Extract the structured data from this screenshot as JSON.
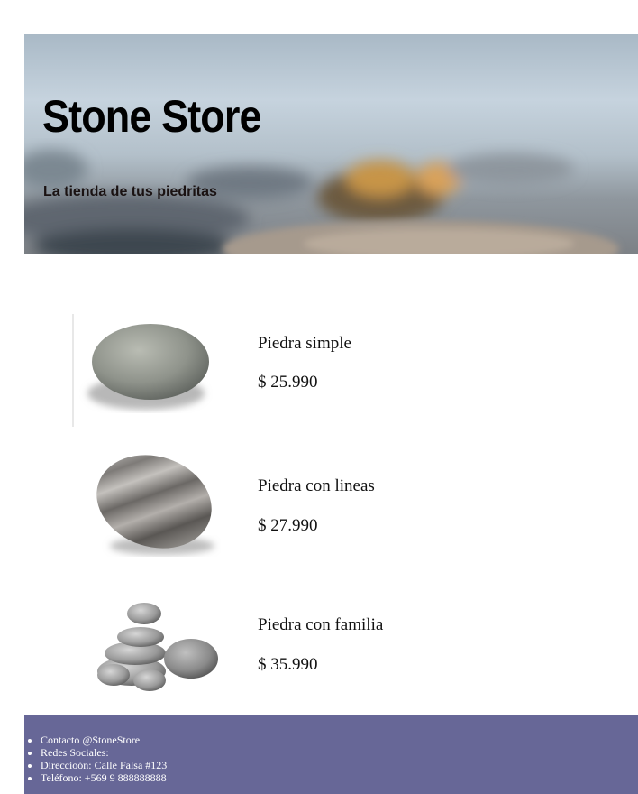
{
  "hero": {
    "title": "Stone Store",
    "tagline": "La tienda de tus piedritas"
  },
  "products": [
    {
      "name": "Piedra simple",
      "price": "$ 25.990",
      "image": "smooth-gray-stone"
    },
    {
      "name": "Piedra con lineas",
      "price": "$ 27.990",
      "image": "striped-stone"
    },
    {
      "name": "Piedra con familia",
      "price": "$ 35.990",
      "image": "stone-stack"
    }
  ],
  "footer": {
    "items": [
      "Contacto @StoneStore",
      "Redes Sociales:",
      "Direccioón: Calle Falsa #123",
      "Teléfono: +569 9 888888888"
    ],
    "background": "#676797"
  }
}
